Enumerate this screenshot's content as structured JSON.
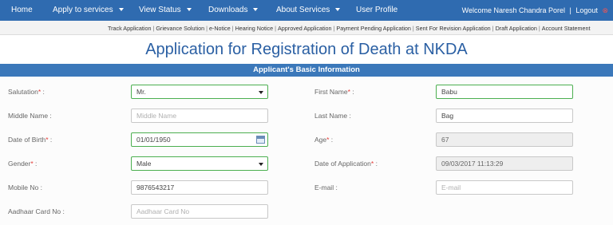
{
  "nav": {
    "home": "Home",
    "apply": "Apply to services",
    "view_status": "View Status",
    "downloads": "Downloads",
    "about": "About Services",
    "profile": "User Profile",
    "welcome": "Welcome Naresh Chandra Porel",
    "logout": "Logout",
    "logout_icon": "⊗"
  },
  "subnav": {
    "links": [
      "Track Application",
      "Grievance Solution",
      "e-Notice",
      "Hearing Notice",
      "Approved Application",
      "Payment Pending Application",
      "Sent For Revision Application",
      "Draft Application",
      "Account Statement"
    ]
  },
  "page": {
    "title": "Application for Registration of Death at NKDA",
    "section": "Applicant's Basic Information"
  },
  "form": {
    "salutation": {
      "label": "Salutation",
      "value": "Mr."
    },
    "first_name": {
      "label": "First Name",
      "value": "Babu"
    },
    "middle_name": {
      "label": "Middle Name :",
      "placeholder": "Middle Name"
    },
    "last_name": {
      "label": "Last Name :",
      "value": "Bag"
    },
    "dob": {
      "label": "Date of Birth",
      "value": "01/01/1950"
    },
    "age": {
      "label": "Age",
      "value": "67"
    },
    "gender": {
      "label": "Gender",
      "value": "Male"
    },
    "date_of_application": {
      "label": "Date of Application",
      "value": "09/03/2017 11:13:29"
    },
    "mobile": {
      "label": "Mobile No :",
      "value": "9876543217"
    },
    "email": {
      "label": "E-mail :",
      "placeholder": "E-mail"
    },
    "aadhaar": {
      "label": "Aadhaar Card No :",
      "placeholder": "Aadhaar Card No"
    }
  },
  "colors": {
    "nav_bg": "#2f6bb0",
    "section_bg": "#3b78ba",
    "title": "#2a5fa3",
    "required": "#e53935",
    "select_border": "#4caf50"
  }
}
